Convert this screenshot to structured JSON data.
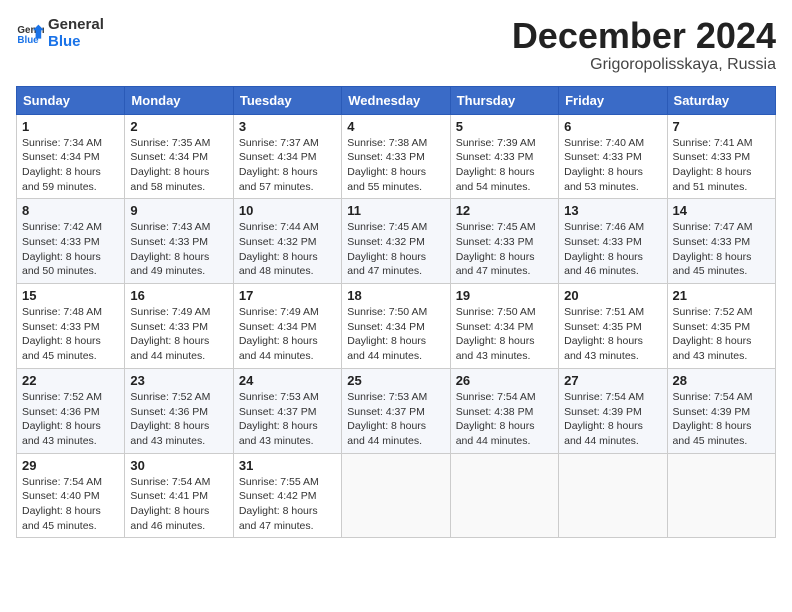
{
  "header": {
    "logo_general": "General",
    "logo_blue": "Blue",
    "month_title": "December 2024",
    "location": "Grigoropolisskaya, Russia"
  },
  "calendar": {
    "days_of_week": [
      "Sunday",
      "Monday",
      "Tuesday",
      "Wednesday",
      "Thursday",
      "Friday",
      "Saturday"
    ],
    "weeks": [
      [
        {
          "day": "1",
          "sunrise": "7:34 AM",
          "sunset": "4:34 PM",
          "daylight": "8 hours and 59 minutes."
        },
        {
          "day": "2",
          "sunrise": "7:35 AM",
          "sunset": "4:34 PM",
          "daylight": "8 hours and 58 minutes."
        },
        {
          "day": "3",
          "sunrise": "7:37 AM",
          "sunset": "4:34 PM",
          "daylight": "8 hours and 57 minutes."
        },
        {
          "day": "4",
          "sunrise": "7:38 AM",
          "sunset": "4:33 PM",
          "daylight": "8 hours and 55 minutes."
        },
        {
          "day": "5",
          "sunrise": "7:39 AM",
          "sunset": "4:33 PM",
          "daylight": "8 hours and 54 minutes."
        },
        {
          "day": "6",
          "sunrise": "7:40 AM",
          "sunset": "4:33 PM",
          "daylight": "8 hours and 53 minutes."
        },
        {
          "day": "7",
          "sunrise": "7:41 AM",
          "sunset": "4:33 PM",
          "daylight": "8 hours and 51 minutes."
        }
      ],
      [
        {
          "day": "8",
          "sunrise": "7:42 AM",
          "sunset": "4:33 PM",
          "daylight": "8 hours and 50 minutes."
        },
        {
          "day": "9",
          "sunrise": "7:43 AM",
          "sunset": "4:33 PM",
          "daylight": "8 hours and 49 minutes."
        },
        {
          "day": "10",
          "sunrise": "7:44 AM",
          "sunset": "4:32 PM",
          "daylight": "8 hours and 48 minutes."
        },
        {
          "day": "11",
          "sunrise": "7:45 AM",
          "sunset": "4:32 PM",
          "daylight": "8 hours and 47 minutes."
        },
        {
          "day": "12",
          "sunrise": "7:45 AM",
          "sunset": "4:33 PM",
          "daylight": "8 hours and 47 minutes."
        },
        {
          "day": "13",
          "sunrise": "7:46 AM",
          "sunset": "4:33 PM",
          "daylight": "8 hours and 46 minutes."
        },
        {
          "day": "14",
          "sunrise": "7:47 AM",
          "sunset": "4:33 PM",
          "daylight": "8 hours and 45 minutes."
        }
      ],
      [
        {
          "day": "15",
          "sunrise": "7:48 AM",
          "sunset": "4:33 PM",
          "daylight": "8 hours and 45 minutes."
        },
        {
          "day": "16",
          "sunrise": "7:49 AM",
          "sunset": "4:33 PM",
          "daylight": "8 hours and 44 minutes."
        },
        {
          "day": "17",
          "sunrise": "7:49 AM",
          "sunset": "4:34 PM",
          "daylight": "8 hours and 44 minutes."
        },
        {
          "day": "18",
          "sunrise": "7:50 AM",
          "sunset": "4:34 PM",
          "daylight": "8 hours and 44 minutes."
        },
        {
          "day": "19",
          "sunrise": "7:50 AM",
          "sunset": "4:34 PM",
          "daylight": "8 hours and 43 minutes."
        },
        {
          "day": "20",
          "sunrise": "7:51 AM",
          "sunset": "4:35 PM",
          "daylight": "8 hours and 43 minutes."
        },
        {
          "day": "21",
          "sunrise": "7:52 AM",
          "sunset": "4:35 PM",
          "daylight": "8 hours and 43 minutes."
        }
      ],
      [
        {
          "day": "22",
          "sunrise": "7:52 AM",
          "sunset": "4:36 PM",
          "daylight": "8 hours and 43 minutes."
        },
        {
          "day": "23",
          "sunrise": "7:52 AM",
          "sunset": "4:36 PM",
          "daylight": "8 hours and 43 minutes."
        },
        {
          "day": "24",
          "sunrise": "7:53 AM",
          "sunset": "4:37 PM",
          "daylight": "8 hours and 43 minutes."
        },
        {
          "day": "25",
          "sunrise": "7:53 AM",
          "sunset": "4:37 PM",
          "daylight": "8 hours and 44 minutes."
        },
        {
          "day": "26",
          "sunrise": "7:54 AM",
          "sunset": "4:38 PM",
          "daylight": "8 hours and 44 minutes."
        },
        {
          "day": "27",
          "sunrise": "7:54 AM",
          "sunset": "4:39 PM",
          "daylight": "8 hours and 44 minutes."
        },
        {
          "day": "28",
          "sunrise": "7:54 AM",
          "sunset": "4:39 PM",
          "daylight": "8 hours and 45 minutes."
        }
      ],
      [
        {
          "day": "29",
          "sunrise": "7:54 AM",
          "sunset": "4:40 PM",
          "daylight": "8 hours and 45 minutes."
        },
        {
          "day": "30",
          "sunrise": "7:54 AM",
          "sunset": "4:41 PM",
          "daylight": "8 hours and 46 minutes."
        },
        {
          "day": "31",
          "sunrise": "7:55 AM",
          "sunset": "4:42 PM",
          "daylight": "8 hours and 47 minutes."
        },
        null,
        null,
        null,
        null
      ]
    ],
    "labels": {
      "sunrise": "Sunrise:",
      "sunset": "Sunset:",
      "daylight": "Daylight:"
    }
  }
}
